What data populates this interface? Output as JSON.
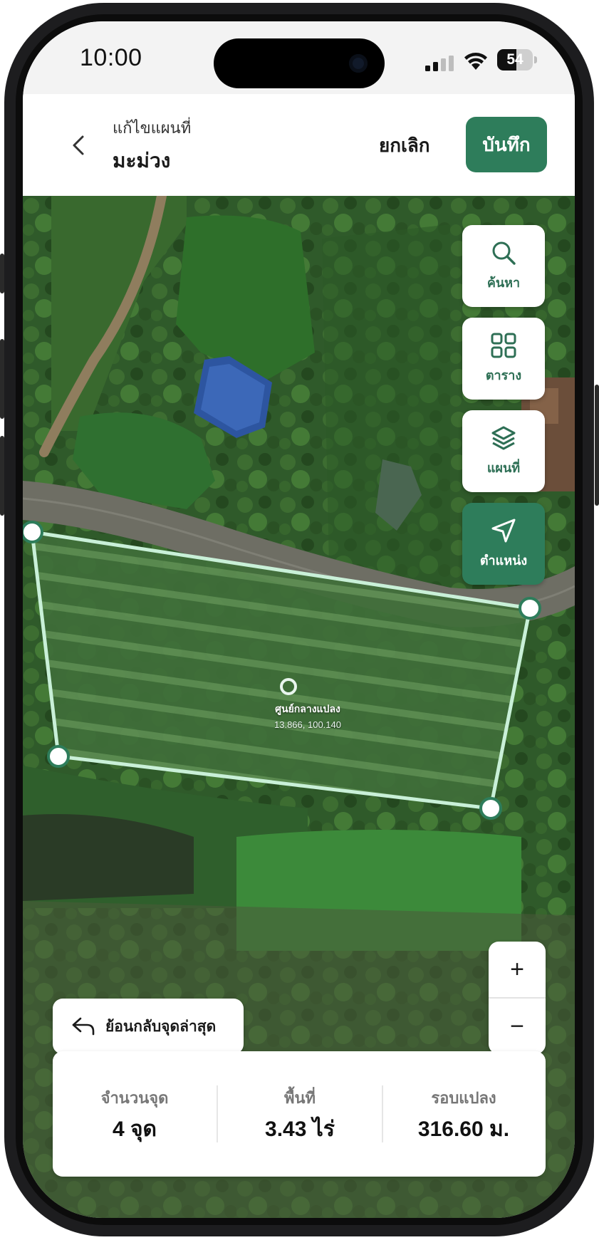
{
  "status_bar": {
    "time": "10:00",
    "battery": "54",
    "battery_level": 0.54
  },
  "header": {
    "subtitle": "แก้ไขแผนที่",
    "title": "มะม่วง",
    "cancel_label": "ยกเลิก",
    "save_label": "บันทึก"
  },
  "tools": [
    {
      "label": "ค้นหา",
      "icon": "search-icon"
    },
    {
      "label": "ตาราง",
      "icon": "grid-icon"
    },
    {
      "label": "แผนที่",
      "icon": "layers-icon"
    },
    {
      "label": "ตำแหน่ง",
      "icon": "location-arrow-icon",
      "active": true
    }
  ],
  "zoom": {
    "in": "+",
    "out": "−"
  },
  "centroid": {
    "label": "ศูนย์กลางแปลง",
    "coords": "13.866, 100.140"
  },
  "undo": {
    "label": "ย้อนกลับจุดล่าสุด"
  },
  "stats": [
    {
      "label": "จำนวนจุด",
      "value": "4 จุด"
    },
    {
      "label": "พื้นที่",
      "value": "3.43 ไร่"
    },
    {
      "label": "รอบแปลง",
      "value": "316.60 ม."
    }
  ],
  "colors": {
    "accent": "#2e7d5b",
    "polygon_stroke": "#c9f0d8"
  }
}
